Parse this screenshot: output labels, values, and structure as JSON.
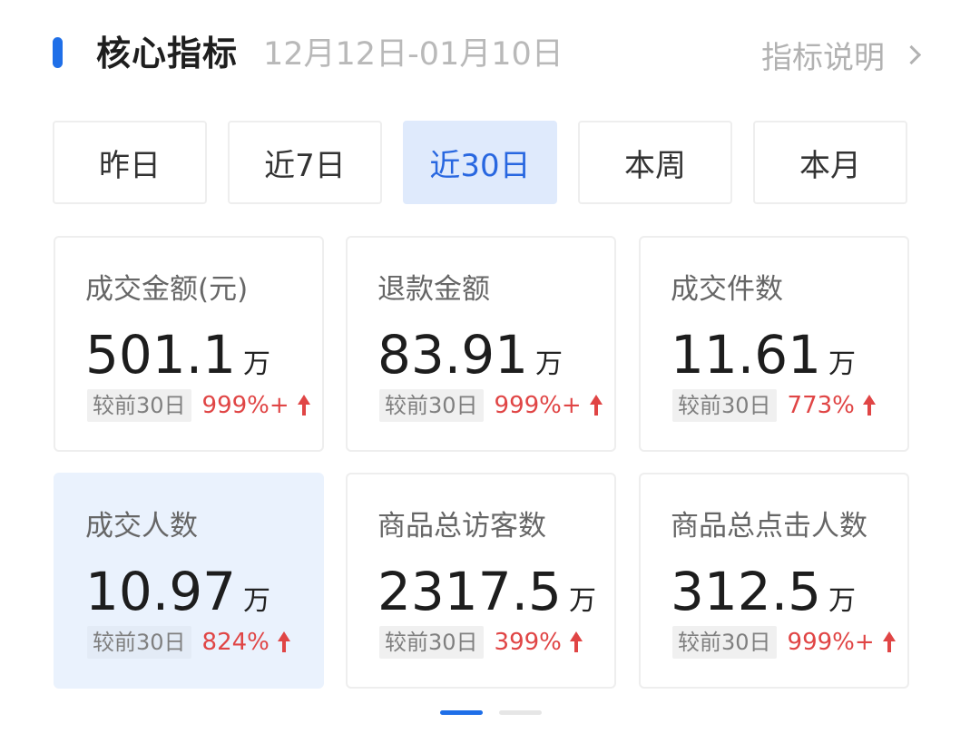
{
  "header": {
    "title": "核心指标",
    "date_range": "12月12日-01月10日",
    "help_link": "指标说明",
    "accent_color": "#1f6fe8"
  },
  "tabs": [
    {
      "label": "昨日",
      "active": false
    },
    {
      "label": "近7日",
      "active": false
    },
    {
      "label": "近30日",
      "active": true
    },
    {
      "label": "本周",
      "active": false
    },
    {
      "label": "本月",
      "active": false
    }
  ],
  "metrics": [
    {
      "label": "成交金额(元)",
      "value": "501.1",
      "unit": "万",
      "compare_label": "较前30日",
      "change": "999%+",
      "trend": "up",
      "selected": false
    },
    {
      "label": "退款金额",
      "value": "83.91",
      "unit": "万",
      "compare_label": "较前30日",
      "change": "999%+",
      "trend": "up",
      "selected": false
    },
    {
      "label": "成交件数",
      "value": "11.61",
      "unit": "万",
      "compare_label": "较前30日",
      "change": "773%",
      "trend": "up",
      "selected": false
    },
    {
      "label": "成交人数",
      "value": "10.97",
      "unit": "万",
      "compare_label": "较前30日",
      "change": "824%",
      "trend": "up",
      "selected": true
    },
    {
      "label": "商品总访客数",
      "value": "2317.5",
      "unit": "万",
      "compare_label": "较前30日",
      "change": "399%",
      "trend": "up",
      "selected": false
    },
    {
      "label": "商品总点击人数",
      "value": "312.5",
      "unit": "万",
      "compare_label": "较前30日",
      "change": "999%+",
      "trend": "up",
      "selected": false
    }
  ],
  "pager": {
    "current_page": 1,
    "total_pages": 2
  },
  "colors": {
    "up": "#e04545",
    "active_tab_bg": "#dfeafc",
    "active_tab_text": "#2867e0",
    "selected_card_bg": "#eaf2fd"
  }
}
